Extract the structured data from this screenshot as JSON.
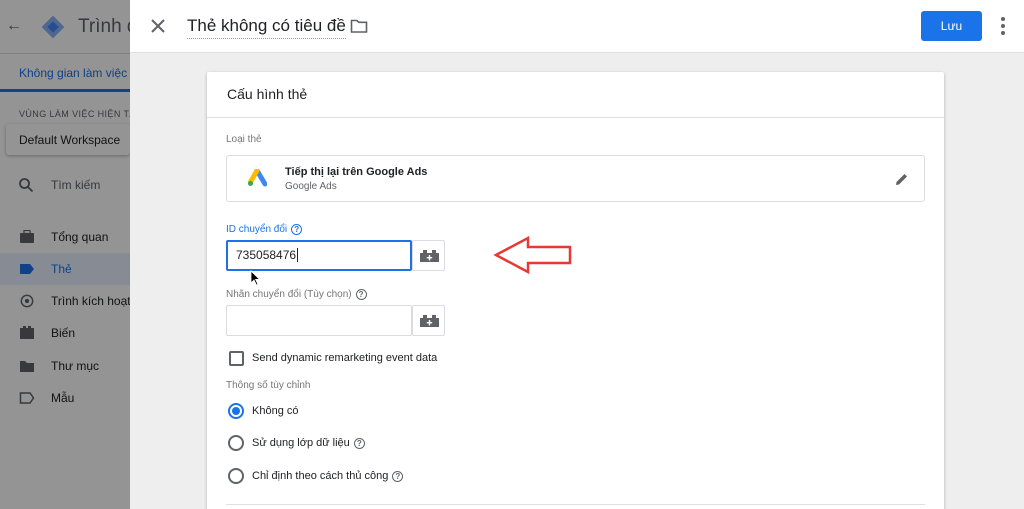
{
  "app": {
    "title": "Trình q",
    "workspace_tab": "Không gian làm việc",
    "workspace_label": "VÙNG LÀM VIỆC HIỆN TẠ",
    "workspace_name": "Default Workspace",
    "search_placeholder": "Tìm kiếm",
    "nav": [
      {
        "label": "Tổng quan",
        "icon": "briefcase-icon"
      },
      {
        "label": "Thẻ",
        "icon": "tag-icon"
      },
      {
        "label": "Trình kích hoạt",
        "icon": "trigger-icon"
      },
      {
        "label": "Biến",
        "icon": "variable-icon"
      },
      {
        "label": "Thư mục",
        "icon": "folder-icon"
      },
      {
        "label": "Mẫu",
        "icon": "template-icon"
      }
    ]
  },
  "sheet": {
    "title": "Thẻ không có tiêu đề",
    "save_label": "Lưu"
  },
  "card": {
    "title": "Cấu hình thẻ",
    "tag_type_label": "Loại thẻ",
    "tag_type_name": "Tiếp thị lại trên Google Ads",
    "tag_type_sub": "Google Ads",
    "conversion_id_label": "ID chuyển đổi",
    "conversion_id_value": "735058476",
    "conversion_label_label": "Nhãn chuyển đổi (Tùy chọn)",
    "conversion_label_value": "",
    "dynamic_checkbox_label": "Send dynamic remarketing event data",
    "custom_params_label": "Thông số tùy chỉnh",
    "radio_options": [
      {
        "label": "Không có",
        "selected": true
      },
      {
        "label": "Sử dụng lớp dữ liệu",
        "selected": false
      },
      {
        "label": "Chỉ định theo cách thủ công",
        "selected": false
      }
    ]
  },
  "colors": {
    "accent": "#1a73e8",
    "annotation_arrow": "#e53935"
  }
}
